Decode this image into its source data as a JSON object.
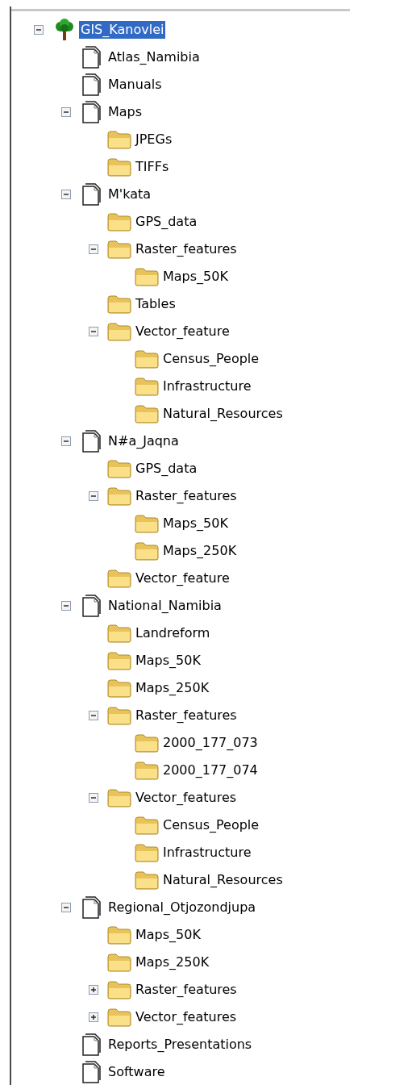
{
  "tree": [
    {
      "label": "GIS_Kanovlei",
      "kind": "tree",
      "expanded": true,
      "selected": true,
      "children": [
        {
          "label": "Atlas_Namibia",
          "kind": "document",
          "selected": false
        },
        {
          "label": "Manuals",
          "kind": "document",
          "selected": false
        },
        {
          "label": "Maps",
          "kind": "document",
          "expanded": true,
          "selected": false,
          "children": [
            {
              "label": "JPEGs",
              "kind": "folder",
              "selected": false
            },
            {
              "label": "TIFFs",
              "kind": "folder",
              "selected": false
            }
          ]
        },
        {
          "label": "M'kata",
          "kind": "document",
          "expanded": true,
          "selected": false,
          "children": [
            {
              "label": "GPS_data",
              "kind": "folder",
              "selected": false
            },
            {
              "label": "Raster_features",
              "kind": "folder",
              "expanded": true,
              "selected": false,
              "children": [
                {
                  "label": "Maps_50K",
                  "kind": "folder",
                  "selected": false
                }
              ]
            },
            {
              "label": "Tables",
              "kind": "folder",
              "selected": false
            },
            {
              "label": "Vector_feature",
              "kind": "folder",
              "expanded": true,
              "selected": false,
              "children": [
                {
                  "label": "Census_People",
                  "kind": "folder",
                  "selected": false
                },
                {
                  "label": "Infrastructure",
                  "kind": "folder",
                  "selected": false
                },
                {
                  "label": "Natural_Resources",
                  "kind": "folder",
                  "selected": false
                }
              ]
            }
          ]
        },
        {
          "label": "N#a_Jaqna",
          "kind": "document",
          "expanded": true,
          "selected": false,
          "children": [
            {
              "label": "GPS_data",
              "kind": "folder",
              "selected": false
            },
            {
              "label": "Raster_features",
              "kind": "folder",
              "expanded": true,
              "selected": false,
              "children": [
                {
                  "label": "Maps_50K",
                  "kind": "folder",
                  "selected": false
                },
                {
                  "label": "Maps_250K",
                  "kind": "folder",
                  "selected": false
                }
              ]
            },
            {
              "label": "Vector_feature",
              "kind": "folder",
              "selected": false
            }
          ]
        },
        {
          "label": "National_Namibia",
          "kind": "document",
          "expanded": true,
          "selected": false,
          "children": [
            {
              "label": "Landreform",
              "kind": "folder",
              "selected": false
            },
            {
              "label": "Maps_50K",
              "kind": "folder",
              "selected": false
            },
            {
              "label": "Maps_250K",
              "kind": "folder",
              "selected": false
            },
            {
              "label": "Raster_features",
              "kind": "folder",
              "expanded": true,
              "selected": false,
              "children": [
                {
                  "label": "2000_177_073",
                  "kind": "folder",
                  "selected": false
                },
                {
                  "label": "2000_177_074",
                  "kind": "folder",
                  "selected": false
                }
              ]
            },
            {
              "label": "Vector_features",
              "kind": "folder",
              "expanded": true,
              "selected": false,
              "children": [
                {
                  "label": "Census_People",
                  "kind": "folder",
                  "selected": false
                },
                {
                  "label": "Infrastructure",
                  "kind": "folder",
                  "selected": false
                },
                {
                  "label": "Natural_Resources",
                  "kind": "folder",
                  "selected": false
                }
              ]
            }
          ]
        },
        {
          "label": "Regional_Otjozondjupa",
          "kind": "document",
          "expanded": true,
          "selected": false,
          "children": [
            {
              "label": "Maps_50K",
              "kind": "folder",
              "selected": false
            },
            {
              "label": "Maps_250K",
              "kind": "folder",
              "selected": false
            },
            {
              "label": "Raster_features",
              "kind": "folder",
              "expanded": false,
              "selected": false
            },
            {
              "label": "Vector_features",
              "kind": "folder",
              "expanded": false,
              "selected": false
            }
          ]
        },
        {
          "label": "Reports_Presentations",
          "kind": "document",
          "selected": false
        },
        {
          "label": "Software",
          "kind": "document",
          "selected": false
        }
      ]
    }
  ]
}
